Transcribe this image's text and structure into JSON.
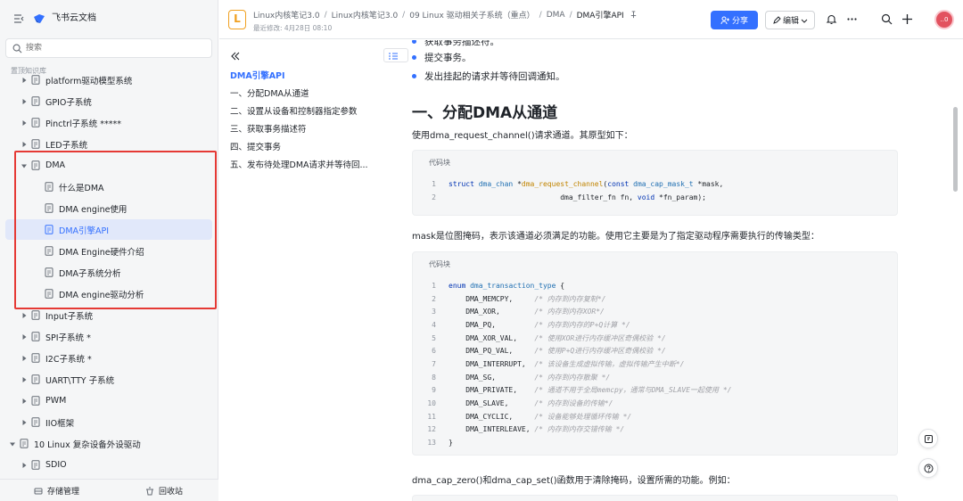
{
  "sidebar": {
    "app_name": "飞书云文档",
    "search_placeholder": "搜索",
    "section_label": "置顶知识库",
    "items": [
      {
        "label": "platform驱动模型系统",
        "level": 2,
        "caret": true
      },
      {
        "label": "GPIO子系统",
        "level": 2,
        "caret": true
      },
      {
        "label": "Pinctrl子系统 *****",
        "level": 2,
        "caret": true
      },
      {
        "label": "LED子系统",
        "level": 2,
        "caret": true
      },
      {
        "label": "DMA",
        "level": 2,
        "caret": true,
        "expanded": true
      },
      {
        "label": "什么是DMA",
        "level": 3,
        "caret": false
      },
      {
        "label": "DMA engine使用",
        "level": 3,
        "caret": false
      },
      {
        "label": "DMA引擎API",
        "level": 3,
        "caret": false,
        "selected": true
      },
      {
        "label": "DMA Engine硬件介绍",
        "level": 3,
        "caret": false
      },
      {
        "label": "DMA子系统分析",
        "level": 3,
        "caret": false
      },
      {
        "label": "DMA engine驱动分析",
        "level": 3,
        "caret": false
      },
      {
        "label": "Input子系统",
        "level": 2,
        "caret": true
      },
      {
        "label": "SPI子系统 *",
        "level": 2,
        "caret": true
      },
      {
        "label": "I2C子系统 *",
        "level": 2,
        "caret": true
      },
      {
        "label": "UART\\TTY 子系统",
        "level": 2,
        "caret": true
      },
      {
        "label": "PWM",
        "level": 2,
        "caret": true
      },
      {
        "label": "IIO框架",
        "level": 2,
        "caret": true
      },
      {
        "label": "10 Linux 复杂设备外设驱动",
        "level": 1,
        "caret": true,
        "expanded": true
      },
      {
        "label": "SDIO",
        "level": 2,
        "caret": true
      }
    ],
    "footer": {
      "storage": "存储管理",
      "trash": "回收站"
    }
  },
  "topbar": {
    "doc_icon_letter": "L",
    "breadcrumbs": [
      "Linux内核笔记3.0",
      "Linux内核笔记3.0",
      "09 Linux 驱动相关子系统（重点）",
      "DMA",
      "DMA引擎API"
    ],
    "modified": "最近修改: 4月28日 08:10",
    "share_label": "分享",
    "edit_label": "编辑",
    "avatar_text": "..0"
  },
  "toc": {
    "title": "DMA引擎API",
    "items": [
      "一、分配DMA从通道",
      "二、设置从设备和控制器指定参数",
      "三、获取事务描述符",
      "四、提交事务",
      "五、发布待处理DMA请求并等待回..."
    ]
  },
  "content": {
    "top_partial": "获取事务描述符。",
    "bullets": [
      "提交事务。",
      "发出挂起的请求并等待回调通知。"
    ],
    "heading": "一、分配DMA从通道",
    "para1": "使用dma_request_channel()请求通道。其原型如下：",
    "code1_label": "代码块",
    "code1": [
      {
        "n": "1",
        "parts": [
          [
            "kw",
            "struct "
          ],
          [
            "ty",
            "dma_chan "
          ],
          [
            "tx",
            "*"
          ],
          [
            "fn",
            "dma_request_channel"
          ],
          [
            "tx",
            "("
          ],
          [
            "kw",
            "const "
          ],
          [
            "ty",
            "dma_cap_mask_t "
          ],
          [
            "tx",
            "*mask,"
          ]
        ]
      },
      {
        "n": "2",
        "parts": [
          [
            "tx",
            "                          dma_filter_fn fn, "
          ],
          [
            "kw",
            "void "
          ],
          [
            "tx",
            "*fn_param);"
          ]
        ]
      }
    ],
    "para2": "mask是位图掩码，表示该通道必须满足的功能。使用它主要是为了指定驱动程序需要执行的传输类型：",
    "code2_label": "代码块",
    "code2": [
      {
        "n": "1",
        "parts": [
          [
            "kw",
            "enum "
          ],
          [
            "ty",
            "dma_transaction_type "
          ],
          [
            "tx",
            "{"
          ]
        ]
      },
      {
        "n": "2",
        "parts": [
          [
            "tx",
            "    DMA_MEMCPY,     "
          ],
          [
            "cm",
            "/* 内存到内存复制*/"
          ]
        ]
      },
      {
        "n": "3",
        "parts": [
          [
            "tx",
            "    DMA_XOR,        "
          ],
          [
            "cm",
            "/* 内存到内存XOR*/"
          ]
        ]
      },
      {
        "n": "4",
        "parts": [
          [
            "tx",
            "    DMA_PQ,         "
          ],
          [
            "cm",
            "/* 内存到内存的P+Q计算 */"
          ]
        ]
      },
      {
        "n": "5",
        "parts": [
          [
            "tx",
            "    DMA_XOR_VAL,    "
          ],
          [
            "cm",
            "/* 使用XOR进行内存缓冲区奇偶校验 */"
          ]
        ]
      },
      {
        "n": "6",
        "parts": [
          [
            "tx",
            "    DMA_PQ_VAL,     "
          ],
          [
            "cm",
            "/* 使用P+Q进行内存缓冲区奇偶校验 */"
          ]
        ]
      },
      {
        "n": "7",
        "parts": [
          [
            "tx",
            "    DMA_INTERRUPT,  "
          ],
          [
            "cm",
            "/* 该设备生成虚拟传输，虚拟传输产生中断*/"
          ]
        ]
      },
      {
        "n": "8",
        "parts": [
          [
            "tx",
            "    DMA_SG,         "
          ],
          [
            "cm",
            "/* 内存到内存散聚 */"
          ]
        ]
      },
      {
        "n": "9",
        "parts": [
          [
            "tx",
            "    DMA_PRIVATE,    "
          ],
          [
            "cm",
            "/* 通道不用于全局memcpy，通常与DMA_SLAVE一起使用 */"
          ]
        ]
      },
      {
        "n": "10",
        "parts": [
          [
            "tx",
            "    DMA_SLAVE,      "
          ],
          [
            "cm",
            "/* 内存到设备的传输*/"
          ]
        ]
      },
      {
        "n": "11",
        "parts": [
          [
            "tx",
            "    DMA_CYCLIC,     "
          ],
          [
            "cm",
            "/* 设备能够处理循环传输 */"
          ]
        ]
      },
      {
        "n": "12",
        "parts": [
          [
            "tx",
            "    DMA_INTERLEAVE, "
          ],
          [
            "cm",
            "/* 内存到内存交错传输 */"
          ]
        ]
      },
      {
        "n": "13",
        "parts": [
          [
            "tx",
            "}"
          ]
        ]
      }
    ],
    "para3": "dma_cap_zero()和dma_cap_set()函数用于清除掩码，设置所需的功能。例如："
  }
}
